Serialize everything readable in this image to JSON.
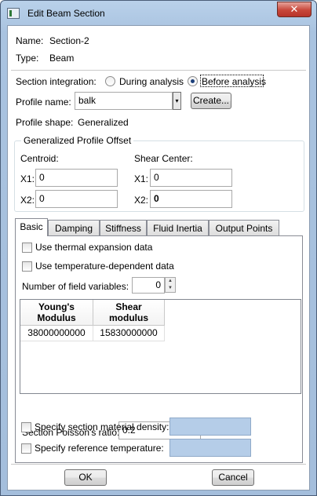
{
  "window": {
    "title": "Edit Beam Section",
    "close_glyph": "✕"
  },
  "name_label": "Name:",
  "name_value": "Section-2",
  "type_label": "Type:",
  "type_value": "Beam",
  "section_integration": {
    "label": "Section integration:",
    "options": [
      "During analysis",
      "Before analysis"
    ],
    "selected": "Before analysis"
  },
  "profile_name": {
    "label": "Profile name:",
    "value": "balk",
    "arrow": "▾",
    "create_button": "Create..."
  },
  "profile_shape": {
    "label": "Profile shape:",
    "value": "Generalized"
  },
  "offset_group": {
    "title": "Generalized Profile Offset",
    "centroid": {
      "label": "Centroid:",
      "x1_label": "X1:",
      "x1": "0",
      "x2_label": "X2:",
      "x2": "0"
    },
    "shear_center": {
      "label": "Shear Center:",
      "x1_label": "X1:",
      "x1": "0",
      "x2_label": "X2:",
      "x2": "0"
    }
  },
  "tabs": [
    "Basic",
    "Damping",
    "Stiffness",
    "Fluid Inertia",
    "Output Points"
  ],
  "active_tab": "Basic",
  "basic": {
    "use_thermal": {
      "label": "Use thermal expansion data",
      "checked": false
    },
    "use_temp_dependent": {
      "label": "Use temperature-dependent data",
      "checked": false
    },
    "field_variables": {
      "label": "Number of field variables:",
      "value": "0",
      "up": "▲",
      "down": "▼"
    },
    "table": {
      "headers": [
        [
          "Young's",
          "Modulus"
        ],
        [
          "Shear",
          "modulus"
        ]
      ],
      "rows": [
        [
          "38000000000",
          "15830000000"
        ]
      ]
    },
    "poisson": {
      "label": "Section Poisson's ratio:",
      "value": "0.2"
    },
    "density": {
      "label": "Specify section material density:",
      "checked": false
    },
    "ref_temp": {
      "label": "Specify reference temperature:",
      "checked": false
    }
  },
  "buttons": {
    "ok": "OK",
    "cancel": "Cancel"
  },
  "colors": {
    "title_bar": "#b9d1ea",
    "disabled_field": "#b5cde8",
    "close_button": "#c8473a"
  }
}
